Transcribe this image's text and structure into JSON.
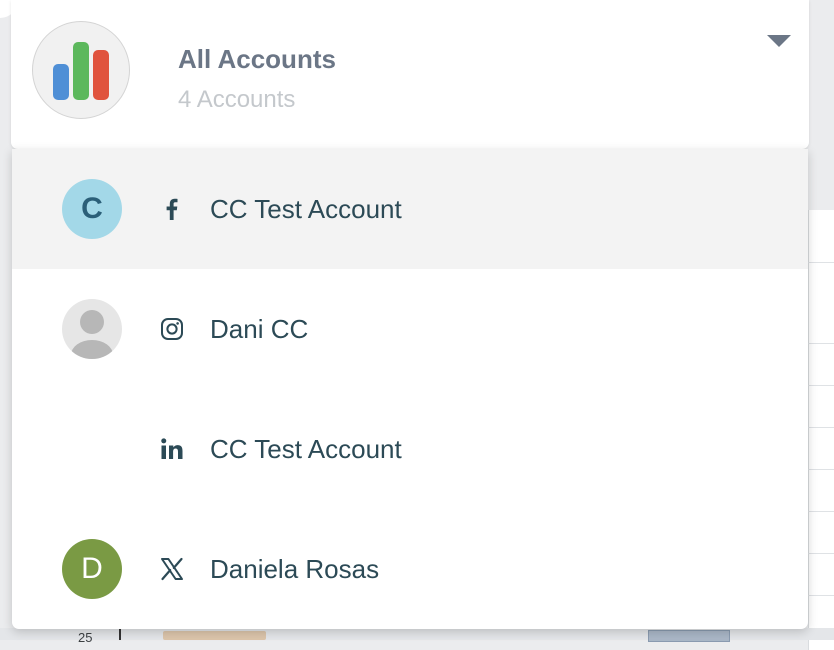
{
  "header": {
    "title": "All Accounts",
    "subtitle": "4 Accounts",
    "logo_icon": "bar-chart-icon",
    "caret_icon": "chevron-down-icon"
  },
  "accounts": [
    {
      "avatar_letter": "C",
      "avatar_color": "#a3d8e8",
      "platform": "facebook",
      "platform_icon": "facebook-icon",
      "name": "CC Test Account",
      "selected": true
    },
    {
      "avatar_letter": "",
      "avatar_color": "#e6e6e6",
      "platform": "instagram",
      "platform_icon": "instagram-icon",
      "name": "Dani CC",
      "selected": false
    },
    {
      "avatar_letter": "",
      "avatar_color": "",
      "platform": "linkedin",
      "platform_icon": "linkedin-icon",
      "name": "CC Test Account",
      "selected": false
    },
    {
      "avatar_letter": "D",
      "avatar_color": "#7a9a44",
      "platform": "x",
      "platform_icon": "x-icon",
      "name": "Daniela Rosas",
      "selected": false
    }
  ],
  "background": {
    "axis_tick": "25"
  },
  "colors": {
    "title_text": "#6b7686",
    "subtitle_text": "#c4c8cc",
    "account_text": "#2c4a56",
    "selected_row": "#f3f3f3",
    "logo_bar_blue": "#4f8fd6",
    "logo_bar_green": "#5cb85c",
    "logo_bar_red": "#e0533d"
  }
}
